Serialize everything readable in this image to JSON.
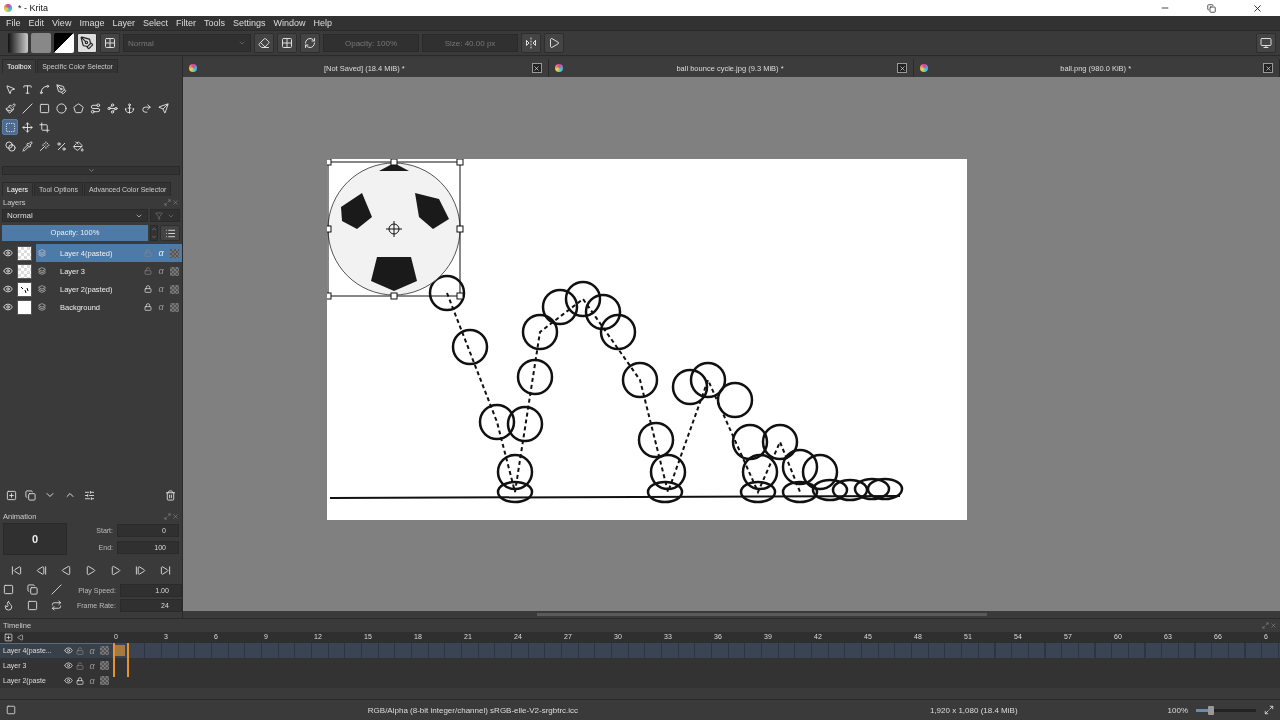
{
  "window": {
    "title": "* - Krita"
  },
  "menu": [
    "File",
    "Edit",
    "View",
    "Image",
    "Layer",
    "Select",
    "Filter",
    "Tools",
    "Settings",
    "Window",
    "Help"
  ],
  "toolbar": {
    "blend_mode": "Normal",
    "opacity": "Opacity: 100%",
    "size": "Size: 40.00 px"
  },
  "toolbox_tabs": [
    {
      "label": "Toolbox",
      "selected": true
    },
    {
      "label": "Specific Color Selector",
      "selected": false
    }
  ],
  "tools": [
    [
      {
        "kind": "pointer",
        "selected": false
      },
      {
        "kind": "text",
        "selected": false
      },
      {
        "kind": "spline",
        "selected": false
      },
      {
        "kind": "pen",
        "selected": false
      }
    ],
    [
      {
        "kind": "brush",
        "selected": false
      },
      {
        "kind": "line",
        "selected": false
      },
      {
        "kind": "rectangle",
        "selected": false
      },
      {
        "kind": "ellipse",
        "selected": false
      },
      {
        "kind": "pentagon",
        "selected": false
      },
      {
        "kind": "route",
        "selected": false
      },
      {
        "kind": "waypoints",
        "selected": false
      },
      {
        "kind": "anchor",
        "selected": false
      },
      {
        "kind": "redo",
        "selected": false
      },
      {
        "kind": "send",
        "selected": false
      }
    ],
    [
      {
        "kind": "dashed-square",
        "selected": true
      },
      {
        "kind": "move",
        "selected": false
      },
      {
        "kind": "crop",
        "selected": false
      }
    ],
    [
      {
        "kind": "blend",
        "selected": false
      },
      {
        "kind": "pipette",
        "selected": false
      },
      {
        "kind": "wand",
        "selected": false
      },
      {
        "kind": "percent",
        "selected": false
      },
      {
        "kind": "paint-bucket",
        "selected": false
      }
    ]
  ],
  "dock_tabs": [
    {
      "label": "Layers",
      "selected": true
    },
    {
      "label": "Tool Options",
      "selected": false
    },
    {
      "label": "Advanced Color Selector",
      "selected": false
    }
  ],
  "layers_panel": {
    "title": "Layers",
    "blend_mode": "Normal",
    "opacity": {
      "label": "Opacity:  100%",
      "level": 1
    },
    "layers": [
      {
        "name": "Layer 4(pasted)",
        "selected": true,
        "visible": true,
        "locked": false,
        "kind": "transparent",
        "alpha_lock": "α"
      },
      {
        "name": "Layer 3",
        "selected": false,
        "visible": true,
        "locked": false,
        "kind": "transparent",
        "alpha_lock": "α"
      },
      {
        "name": "Layer 2(pasted)",
        "selected": false,
        "visible": true,
        "locked": true,
        "kind": "sketch",
        "alpha_lock": "α"
      },
      {
        "name": "Background",
        "selected": false,
        "visible": true,
        "locked": true,
        "kind": "white",
        "alpha_lock": "α"
      }
    ]
  },
  "animation": {
    "title": "Animation",
    "frame": "0",
    "start_label": "Start:",
    "start": "0",
    "end_label": "End:",
    "end": "100",
    "speed_label": "Play Speed:",
    "speed": "1.00",
    "rate_label": "Frame Rate:",
    "rate": "24"
  },
  "documents": [
    {
      "title": "[Not Saved]  (18.4 MiB) *"
    },
    {
      "title": "ball bounce cycle.jpg (9.3 MiB) *"
    },
    {
      "title": "ball.png (980.0 KiB) *"
    }
  ],
  "timeline": {
    "title": "Timeline",
    "ticks": [
      "0",
      "3",
      "6",
      "9",
      "12",
      "15",
      "18",
      "21",
      "24",
      "27",
      "30",
      "33",
      "36",
      "39",
      "42",
      "45",
      "48",
      "51",
      "54",
      "57",
      "60",
      "63",
      "66",
      "6"
    ],
    "rows": [
      {
        "name": "Layer 4(paste...",
        "selected": true,
        "locked": false,
        "alpha_lock": "α"
      },
      {
        "name": "Layer 3",
        "selected": false,
        "locked": false,
        "alpha_lock": "α"
      },
      {
        "name": "Layer 2(paste",
        "selected": false,
        "locked": true,
        "alpha_lock": "α"
      }
    ]
  },
  "status_bar": {
    "color_space": "RGB/Alpha (8-bit integer/channel)  sRGB-elle-V2-srgbtrc.icc",
    "image_size": "1,920 x 1,080 (18.4 MiB)",
    "zoom": "100%",
    "zoom_slider": {
      "level": 0.25
    }
  }
}
